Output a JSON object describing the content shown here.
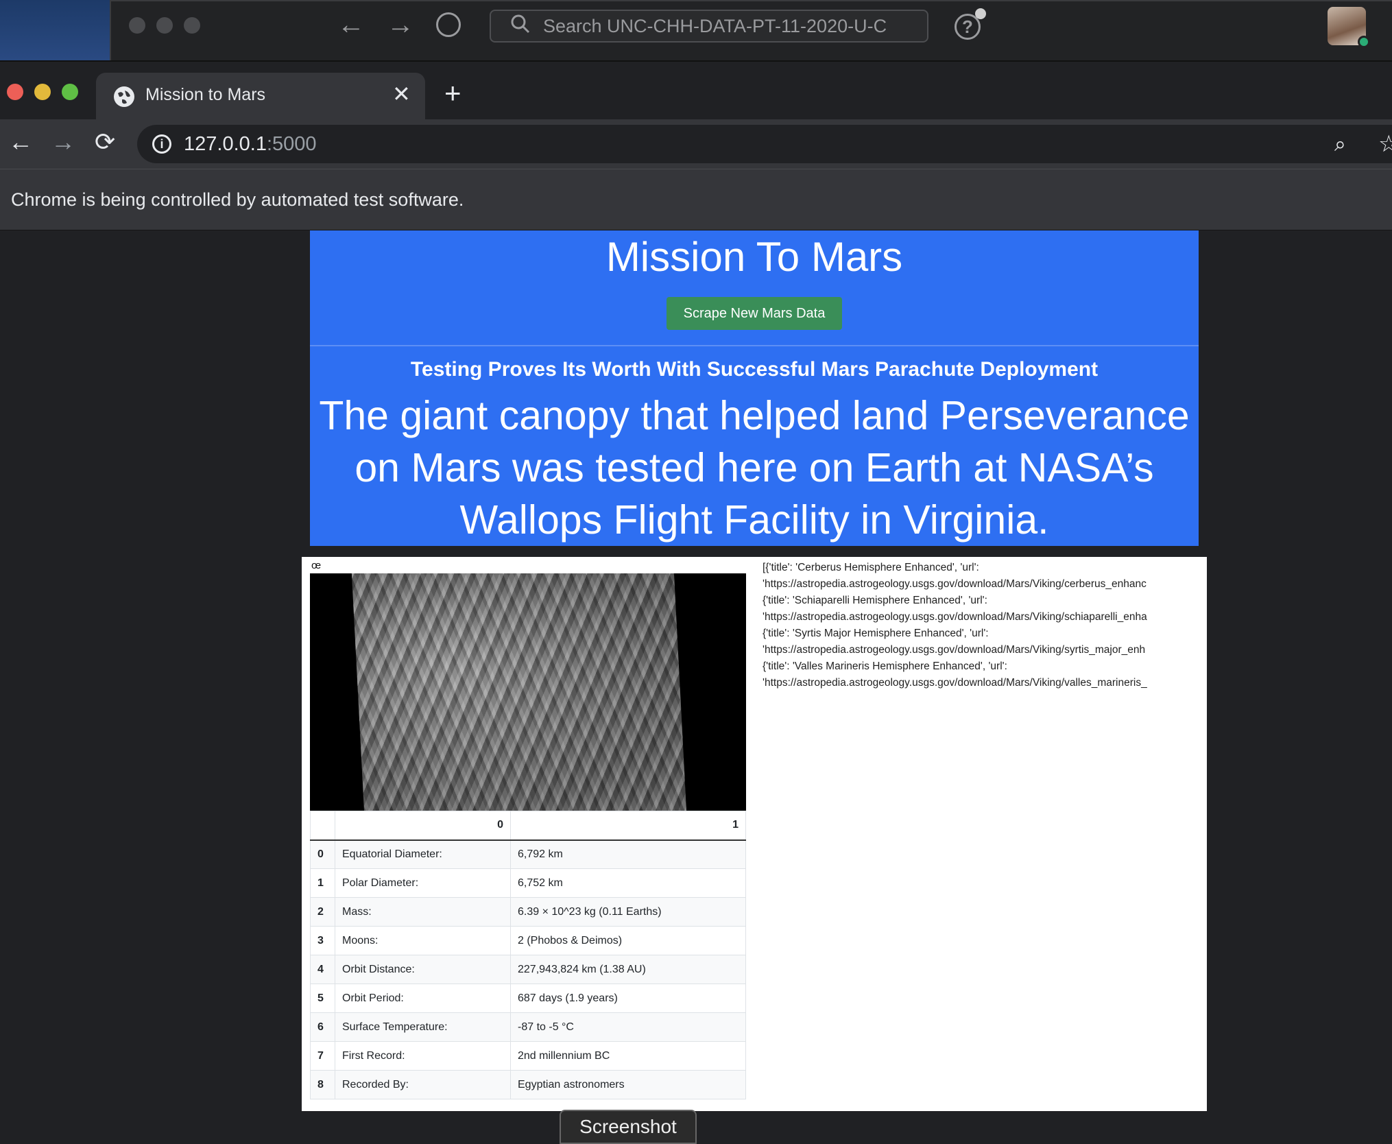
{
  "background_app": {
    "search_placeholder": "Search UNC-CHH-DATA-PT-11-2020-U-C",
    "help_label": "?"
  },
  "browser": {
    "tab_title": "Mission to Mars",
    "url_host": "127.0.0.1",
    "url_port": ":5000",
    "infobar_text": "Chrome is being controlled by automated test software."
  },
  "page": {
    "title": "Mission To Mars",
    "scrape_button": "Scrape New Mars Data",
    "news_title": "Testing Proves Its Worth With Successful Mars Parachute Deployment",
    "news_paragraph": "The giant canopy that helped land Perseverance on Mars was tested here on Earth at NASA’s Wallops Flight Facility in Virginia.",
    "oe_mark": "œ",
    "facts": {
      "columns": [
        "",
        "0",
        "1"
      ],
      "rows": [
        [
          "0",
          "Equatorial Diameter:",
          "6,792 km"
        ],
        [
          "1",
          "Polar Diameter:",
          "6,752 km"
        ],
        [
          "2",
          "Mass:",
          "6.39 × 10^23 kg (0.11 Earths)"
        ],
        [
          "3",
          "Moons:",
          "2 (Phobos & Deimos)"
        ],
        [
          "4",
          "Orbit Distance:",
          "227,943,824 km (1.38 AU)"
        ],
        [
          "5",
          "Orbit Period:",
          "687 days (1.9 years)"
        ],
        [
          "6",
          "Surface Temperature:",
          "-87 to -5 °C"
        ],
        [
          "7",
          "First Record:",
          "2nd millennium BC"
        ],
        [
          "8",
          "Recorded By:",
          "Egyptian astronomers"
        ]
      ]
    },
    "hemispheres_text": "[{'title': 'Cerberus Hemisphere Enhanced', 'url':\n'https://astropedia.astrogeology.usgs.gov/download/Mars/Viking/cerberus_enhanc\n{'title': 'Schiaparelli Hemisphere Enhanced', 'url':\n'https://astropedia.astrogeology.usgs.gov/download/Mars/Viking/schiaparelli_enha\n{'title': 'Syrtis Major Hemisphere Enhanced', 'url':\n'https://astropedia.astrogeology.usgs.gov/download/Mars/Viking/syrtis_major_enh\n{'title': 'Valles Marineris Hemisphere Enhanced', 'url':\n'https://astropedia.astrogeology.usgs.gov/download/Mars/Viking/valles_marineris_"
  },
  "overlay": {
    "screenshot_button": "Screenshot"
  },
  "colors": {
    "jumbotron": "#2e6ff2",
    "scrape_button": "#3a8e58",
    "close_traffic": "#ed5f57",
    "minimize_traffic": "#e2b93b",
    "maximize_traffic": "#5fbf45"
  }
}
